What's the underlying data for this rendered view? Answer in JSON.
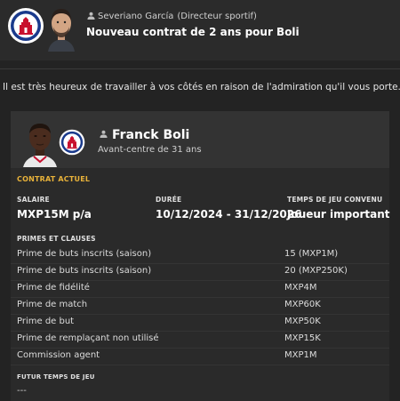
{
  "header": {
    "sender_name": "Severiano García",
    "sender_role": "(Directeur sportif)",
    "subject": "Nouveau contrat de 2 ans pour Boli"
  },
  "message": "Il est très heureux de travailler à vos côtés en raison de l'admiration qu'il vous porte.",
  "player": {
    "name": "Franck Boli",
    "role": "Avant-centre de 31 ans"
  },
  "contract": {
    "section_title": "CONTRAT ACTUEL",
    "salary_label": "SALAIRE",
    "salary_value": "MXP15M p/a",
    "duration_label": "DURÉE",
    "duration_value": "10/12/2024 - 31/12/2026",
    "playing_time_label": "TEMPS DE JEU CONVENU",
    "playing_time_value": "Joueur important"
  },
  "clauses": {
    "title": "PRIMES ET CLAUSES",
    "rows": [
      {
        "label": "Prime de buts inscrits (saison)",
        "value": "15 (MXP1M)"
      },
      {
        "label": "Prime de buts inscrits (saison)",
        "value": "20 (MXP250K)"
      },
      {
        "label": "Prime de fidélité",
        "value": "MXP4M"
      },
      {
        "label": "Prime de match",
        "value": "MXP60K"
      },
      {
        "label": "Prime de but",
        "value": "MXP50K"
      },
      {
        "label": "Prime de remplaçant non utilisé",
        "value": "MXP15K"
      },
      {
        "label": "Commission agent",
        "value": "MXP1M"
      }
    ]
  },
  "future": {
    "title": "FUTUR TEMPS DE JEU",
    "value": "---"
  },
  "colors": {
    "accent": "#e8b23a",
    "background": "#232323",
    "card": "#2a2a2a"
  }
}
